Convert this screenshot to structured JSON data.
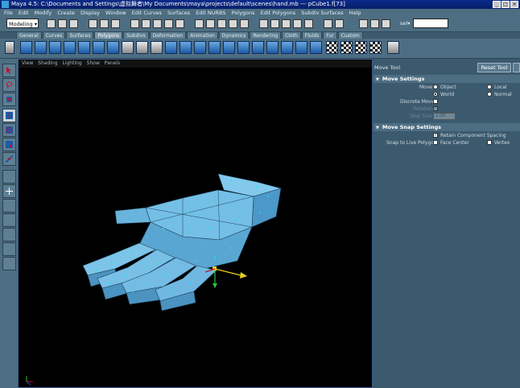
{
  "window": {
    "title": "Maya 4.5: C:\\Documents and Settings\\虚拟舞者\\My Documents\\maya\\projects\\default\\scenes\\hand.mb   ---   pCube1.f[73]"
  },
  "menus": [
    "File",
    "Edit",
    "Modify",
    "Create",
    "Display",
    "Window",
    "Edit Curves",
    "Surfaces",
    "Edit NURBS",
    "Polygons",
    "Edit Polygons",
    "Subdiv Surfaces",
    "Help"
  ],
  "status_line": {
    "mode": "Modeling",
    "select_label": "sel▾"
  },
  "shelf_tabs": [
    "General",
    "Curves",
    "Surfaces",
    "Polygons",
    "Subdivs",
    "Deformation",
    "Animation",
    "Dynamics",
    "Rendering",
    "Cloth",
    "Fluids",
    "Fur",
    "Custom"
  ],
  "active_shelf_tab": "Polygons",
  "panel_menu": [
    "View",
    "Shading",
    "Lighting",
    "Show",
    "Panels"
  ],
  "tool_settings": {
    "title": "Move Tool",
    "reset_label": "Reset Tool",
    "move_settings": {
      "header": "Move Settings",
      "move_label": "Move",
      "options": [
        "Object",
        "Local",
        "World",
        "Normal"
      ],
      "selected": "World",
      "discrete_move": "Discrete Move",
      "rotation": "Rotation",
      "step_size": "Step Size",
      "step_value": "1.00"
    },
    "snap_settings": {
      "header": "Move Snap Settings",
      "retain_spacing": "Retain Component Spacing",
      "snap_live_label": "Snap to Live Polygon",
      "face_center": "Face Center",
      "vertex": "Vertex"
    }
  },
  "colors": {
    "ui_bg": "#4d6e82",
    "mesh": "#6fc0e6",
    "vertex": "#19e0ff",
    "title_bar": "#0b2a8a"
  }
}
